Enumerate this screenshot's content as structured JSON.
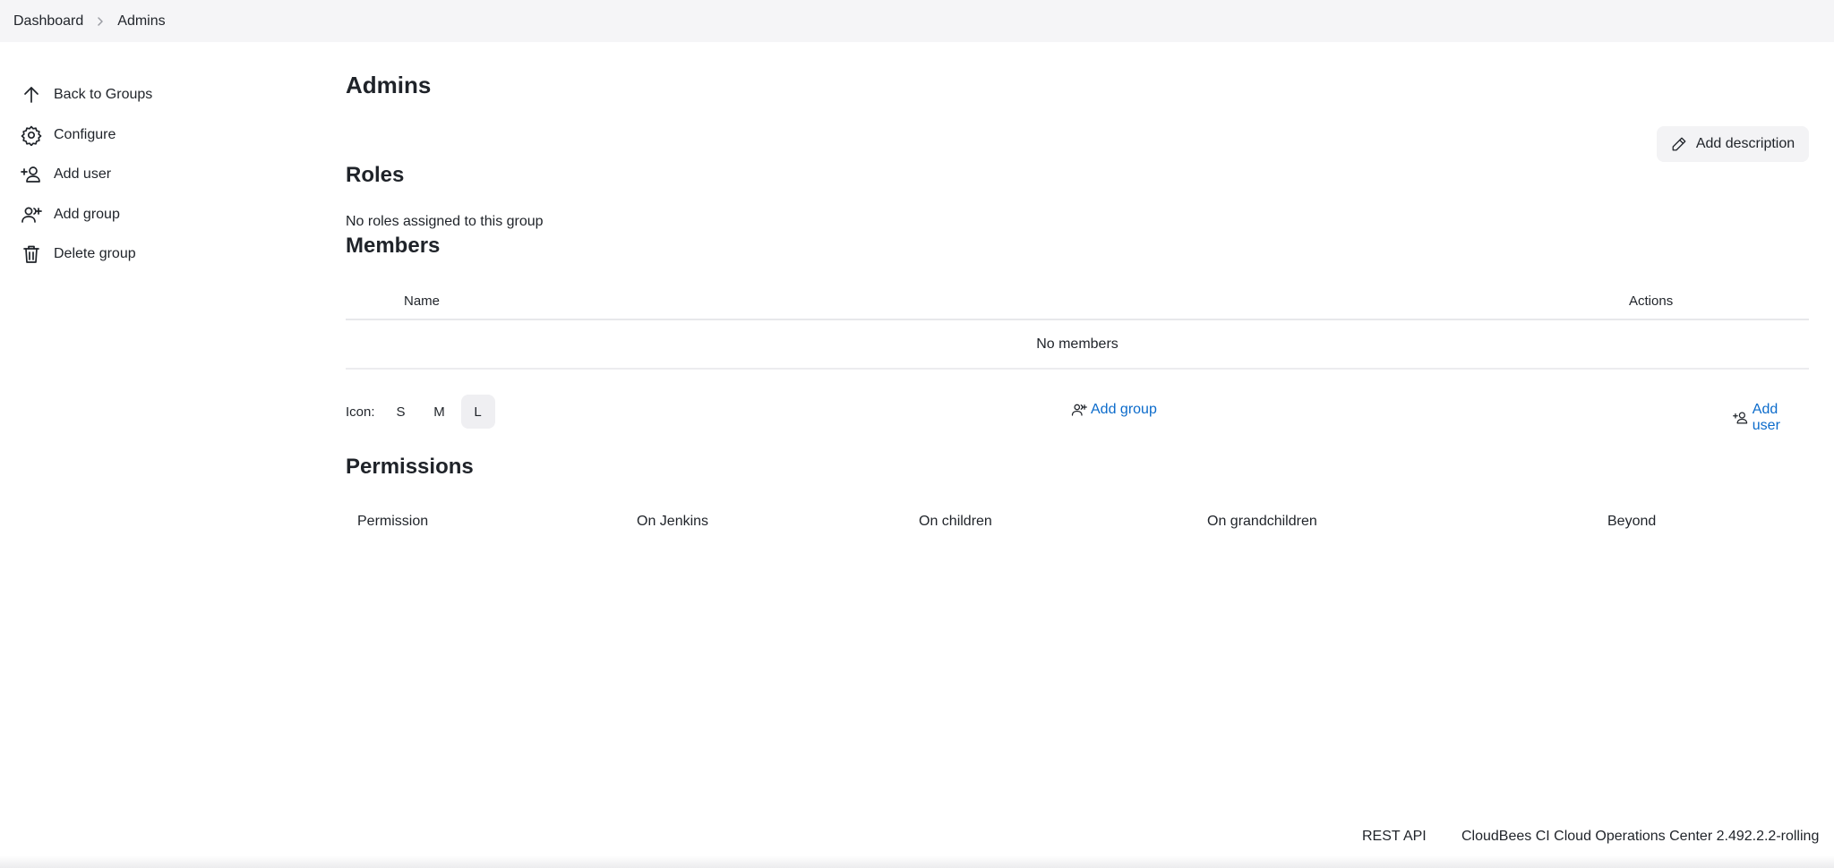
{
  "breadcrumb": {
    "items": [
      "Dashboard",
      "Admins"
    ]
  },
  "sidebar": {
    "items": [
      {
        "label": "Back to Groups",
        "icon": "arrow-up-icon"
      },
      {
        "label": "Configure",
        "icon": "gear-icon"
      },
      {
        "label": "Add user",
        "icon": "add-user-icon"
      },
      {
        "label": "Add group",
        "icon": "add-group-icon"
      },
      {
        "label": "Delete group",
        "icon": "trash-icon"
      }
    ]
  },
  "main": {
    "title": "Admins",
    "add_description_label": "Add description",
    "roles": {
      "heading": "Roles",
      "empty_text": "No roles assigned to this group"
    },
    "members": {
      "heading": "Members",
      "columns": [
        "Name",
        "Actions"
      ],
      "empty_text": "No members"
    },
    "icon_size": {
      "label": "Icon:",
      "options": [
        "S",
        "M",
        "L"
      ],
      "selected": "L"
    },
    "add_group_label": "Add group",
    "add_user_label": "Add user",
    "permissions": {
      "heading": "Permissions",
      "columns": [
        "Permission",
        "On Jenkins",
        "On children",
        "On grandchildren",
        "Beyond"
      ]
    }
  },
  "footer": {
    "rest_api": "REST API",
    "version": "CloudBees CI Cloud Operations Center 2.492.2.2-rolling"
  },
  "colors": {
    "link": "#0b6bcb",
    "topbar_bg": "#f5f5f7",
    "text": "#1f2329"
  }
}
